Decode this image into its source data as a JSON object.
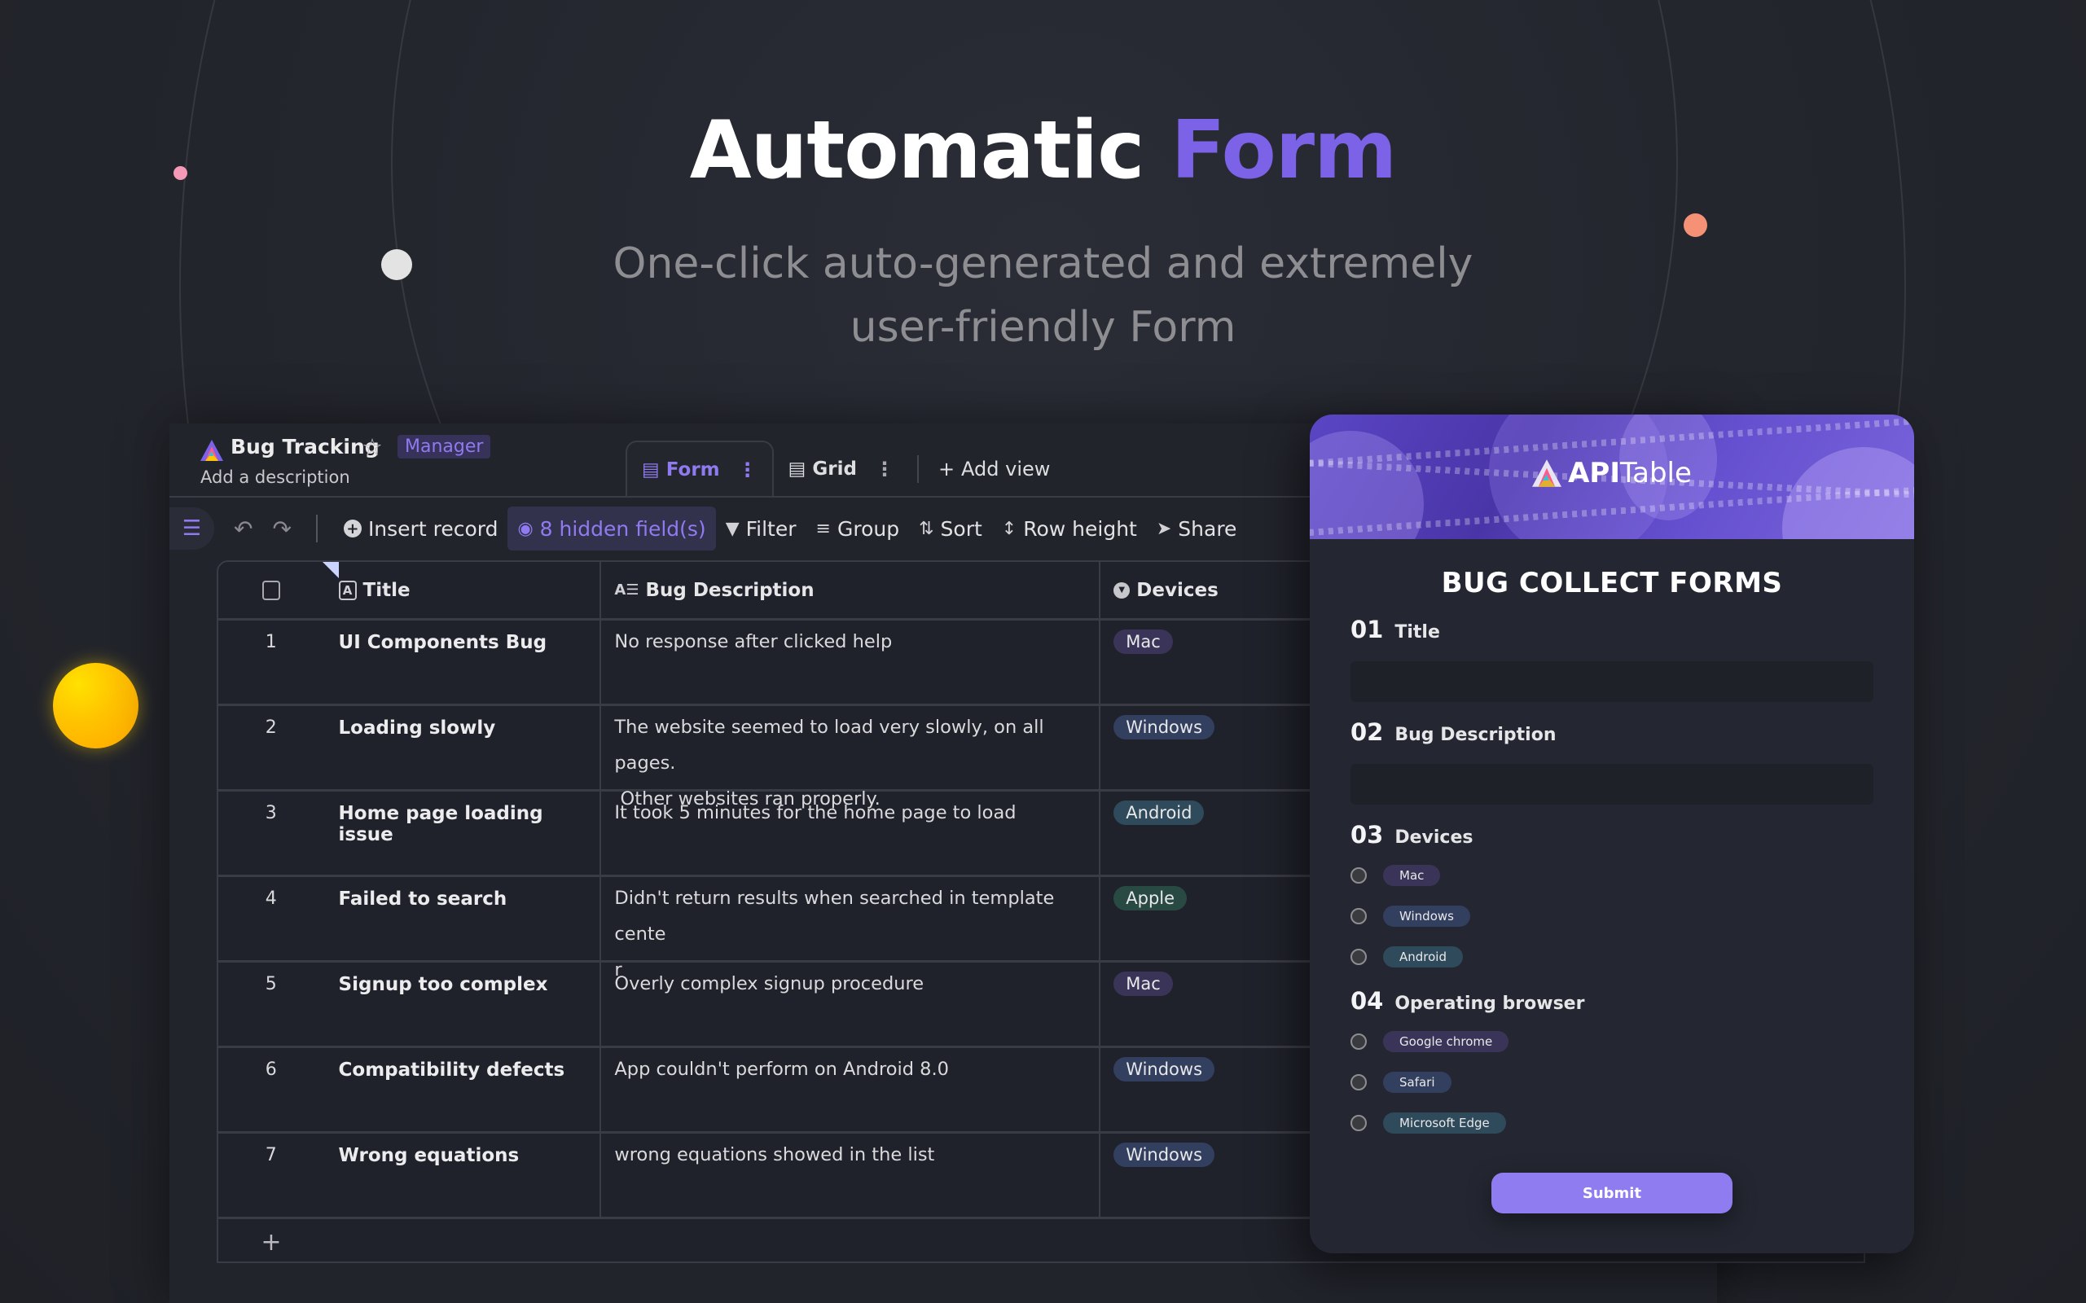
{
  "hero": {
    "title_main": "Automatic",
    "title_accent": "Form",
    "subtitle_line1": "One-click auto-generated and extremely",
    "subtitle_line2": "user-friendly Form"
  },
  "colors": {
    "accent": "#7b62e6",
    "submit": "#8f7cf0",
    "tag_mac": "#3a3558",
    "tag_windows": "#333f5e",
    "tag_android": "#2f4a5a",
    "tag_apple": "#294a42"
  },
  "app": {
    "datasheet_title": "Bug Tracking",
    "role_badge": "Manager",
    "description_placeholder": "Add a description",
    "tabs": [
      {
        "label": "Form",
        "icon": "form-view-icon",
        "active": true
      },
      {
        "label": "Grid",
        "icon": "grid-view-icon",
        "active": false
      }
    ],
    "add_view_label": "Add view",
    "toolbar": {
      "insert_record": "Insert record",
      "hidden_fields": "8 hidden field(s)",
      "filter": "Filter",
      "group": "Group",
      "sort": "Sort",
      "row_height": "Row height",
      "share": "Share"
    },
    "grid": {
      "columns": [
        "Title",
        "Bug Description",
        "Devices"
      ],
      "rows": [
        {
          "num": "1",
          "title": "UI Components Bug",
          "description": "No response after clicked help",
          "device": "Mac"
        },
        {
          "num": "2",
          "title": "Loading slowly",
          "description": "The website seemed to load very slowly, on all pages.\n Other websites ran properly.",
          "device": "Windows"
        },
        {
          "num": "3",
          "title": "Home page loading issue",
          "description": "It took 5 minutes for the home page to load",
          "device": "Android"
        },
        {
          "num": "4",
          "title": "Failed to search",
          "description": "Didn't return results when searched in template cente\nr",
          "device": "Apple"
        },
        {
          "num": "5",
          "title": "Signup too complex",
          "description": "Overly complex signup procedure",
          "device": "Mac"
        },
        {
          "num": "6",
          "title": "Compatibility defects",
          "description": "App couldn't perform on Android 8.0",
          "device": "Windows"
        },
        {
          "num": "7",
          "title": "Wrong equations",
          "description": "wrong equations showed in the list",
          "device": "Windows"
        }
      ],
      "add_row_symbol": "+"
    }
  },
  "form": {
    "brand_bold": "API",
    "brand_light": "Table",
    "title": "BUG COLLECT FORMS",
    "questions": [
      {
        "num": "01",
        "label": "Title",
        "type": "text",
        "value": ""
      },
      {
        "num": "02",
        "label": "Bug Description",
        "type": "text",
        "value": ""
      },
      {
        "num": "03",
        "label": "Devices",
        "type": "choice",
        "options": [
          "Mac",
          "Windows",
          "Android"
        ]
      },
      {
        "num": "04",
        "label": "Operating browser",
        "type": "choice",
        "options": [
          "Google chrome",
          "Safari",
          "Microsoft Edge"
        ]
      }
    ],
    "submit_label": "Submit"
  }
}
